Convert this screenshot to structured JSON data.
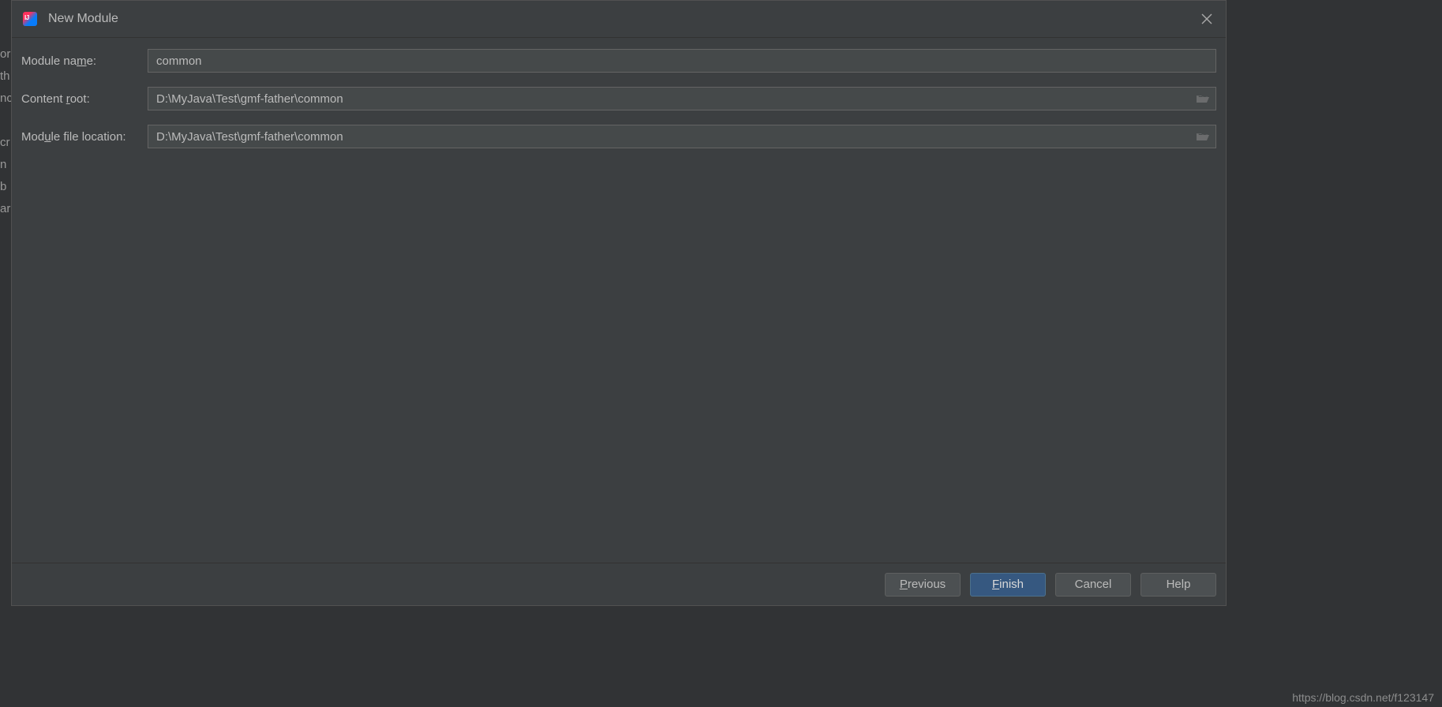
{
  "dialog": {
    "title": "New Module",
    "fields": {
      "module_name": {
        "label_pre": "Module na",
        "label_u": "m",
        "label_post": "e:",
        "value": "common"
      },
      "content_root": {
        "label_pre": "Content ",
        "label_u": "r",
        "label_post": "oot:",
        "value": "D:\\MyJava\\Test\\gmf-father\\common"
      },
      "module_file_location": {
        "label_pre": "Mod",
        "label_u": "u",
        "label_post": "le file location:",
        "value": "D:\\MyJava\\Test\\gmf-father\\common"
      }
    },
    "buttons": {
      "previous_u": "P",
      "previous_post": "revious",
      "finish_u": "F",
      "finish_post": "inish",
      "cancel": "Cancel",
      "help": "Help"
    }
  },
  "watermark": "https://blog.csdn.net/f123147",
  "bg_fragments": "or\nth\nnc\n\ncr\nn\nb\nar"
}
